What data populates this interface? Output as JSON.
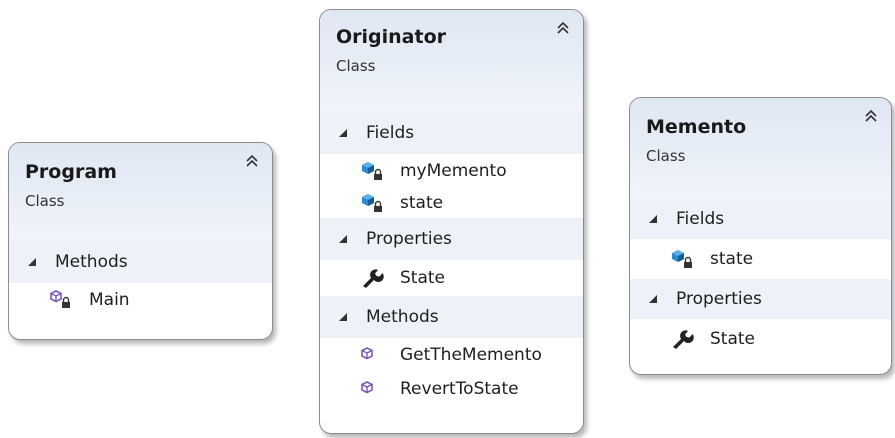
{
  "classes": {
    "program": {
      "name": "Program",
      "kind": "Class",
      "methods_label": "Methods",
      "methods": [
        "Main"
      ]
    },
    "originator": {
      "name": "Originator",
      "kind": "Class",
      "fields_label": "Fields",
      "fields": [
        "myMemento",
        "state"
      ],
      "properties_label": "Properties",
      "properties": [
        "State"
      ],
      "methods_label": "Methods",
      "methods": [
        "GetTheMemento",
        "RevertToState"
      ]
    },
    "memento": {
      "name": "Memento",
      "kind": "Class",
      "fields_label": "Fields",
      "fields": [
        "state"
      ],
      "properties_label": "Properties",
      "properties": [
        "State"
      ]
    }
  },
  "icons": {
    "collapse": "double-chevron-up-icon",
    "section": "triangle-expanded-icon",
    "private_field": "private-field-icon",
    "property": "wrench-property-icon",
    "public_method": "method-cube-icon",
    "private_method": "private-method-cube-icon"
  },
  "colors": {
    "header_bg": "#e3eaf5",
    "section_bg": "#edf2f9",
    "border": "#8c8c8c",
    "field_icon": "#1f7fc4",
    "method_icon": "#7b56b8"
  }
}
